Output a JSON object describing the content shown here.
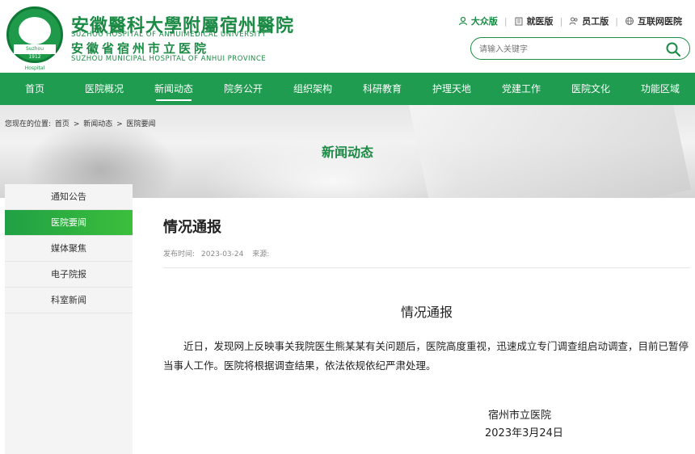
{
  "header": {
    "brand_cn_1": "安徽醫科大學附屬宿州醫院",
    "brand_en_1": "SUZHOU HOSPITAL OF ANHUIMEDICAL UNIVERSITY",
    "brand_cn_2": "安徽省宿州市立医院",
    "brand_en_2": "SUZHOU MUNICIPAL HOSPITAL OF ANHUI PROVINCE",
    "logo_ribbon": "Suzhou Municipal Hospital",
    "logo_year": "1912",
    "top_links": [
      {
        "label": "大众版",
        "icon": "person-icon"
      },
      {
        "label": "就医版",
        "icon": "building-icon"
      },
      {
        "label": "员工版",
        "icon": "staff-icon"
      },
      {
        "label": "互联网医院",
        "icon": "globe-icon"
      }
    ],
    "search_placeholder": "请输入关键字"
  },
  "nav": {
    "items": [
      "首页",
      "医院概况",
      "新闻动态",
      "院务公开",
      "组织架构",
      "科研教育",
      "护理天地",
      "党建工作",
      "医院文化",
      "功能区域"
    ],
    "active_index": 2
  },
  "banner": {
    "breadcrumb": [
      "您现在的位置:",
      "首页",
      ">",
      "新闻动态",
      ">",
      "医院要闻"
    ],
    "title": "新闻动态"
  },
  "sidebar": {
    "items": [
      "通知公告",
      "医院要闻",
      "媒体聚焦",
      "电子院报",
      "科室新闻"
    ],
    "active_index": 1
  },
  "article": {
    "title": "情况通报",
    "publish_label": "发布时间:",
    "publish_date": "2023-03-24",
    "source_label": "来源:",
    "doc_title": "情况通报",
    "body": "近日，发现网上反映事关我院医生熊某某有关问题后，医院高度重视，迅速成立专门调查组启动调查，目前已暂停当事人工作。医院将根据调查结果，依法依规依纪严肃处理。",
    "signature_org": "宿州市立医院",
    "signature_date": "2023年3月24日"
  },
  "colors": {
    "brand_green": "#1b8a45",
    "nav_green": "#1f9c50",
    "active_side": "#2aa845"
  }
}
